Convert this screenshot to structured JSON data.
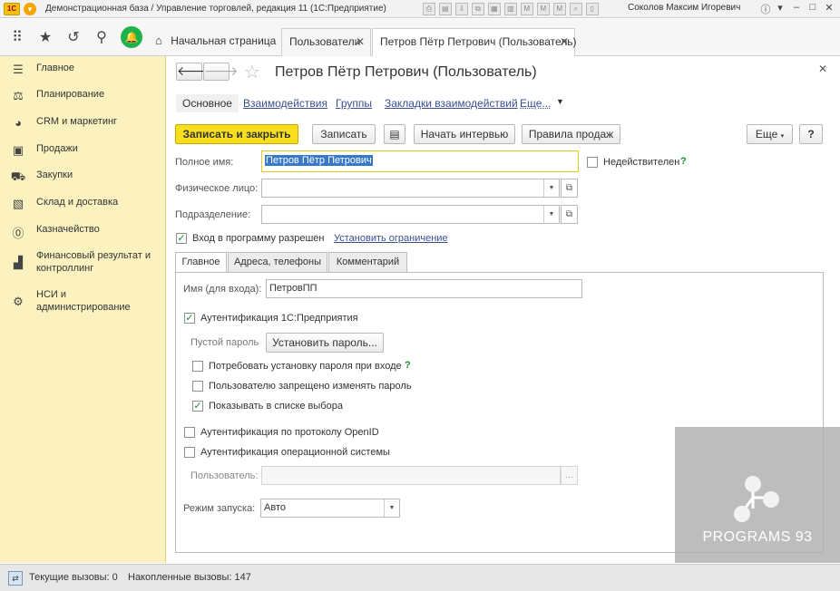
{
  "window": {
    "title": "Демонстрационная база / Управление торговлей, редакция 11  (1С:Предприятие)",
    "user": "Соколов Максим Игоревич",
    "logo_text": "1С"
  },
  "tabs": {
    "home": "Начальная страница",
    "users": "Пользователи",
    "current": "Петров Пётр Петрович (Пользователь)"
  },
  "sidebar": {
    "items": [
      {
        "label": "Главное",
        "icon": "menu-icon"
      },
      {
        "label": "Планирование",
        "icon": "planning-icon"
      },
      {
        "label": "CRM и маркетинг",
        "icon": "crm-icon"
      },
      {
        "label": "Продажи",
        "icon": "sales-icon"
      },
      {
        "label": "Закупки",
        "icon": "purchases-icon"
      },
      {
        "label": "Склад и доставка",
        "icon": "warehouse-icon"
      },
      {
        "label": "Казначейство",
        "icon": "treasury-icon"
      },
      {
        "label": "Финансовый результат и контроллинг",
        "icon": "finance-chart-icon"
      },
      {
        "label": "НСИ и администрирование",
        "icon": "gear-icon"
      }
    ]
  },
  "form": {
    "title": "Петров Пётр Петрович (Пользователь)",
    "sections": {
      "main": "Основное",
      "interactions": "Взаимодействия",
      "groups": "Группы",
      "bookmarks": "Закладки взаимодействий",
      "more": "Еще..."
    },
    "toolbar": {
      "save_close": "Записать и закрыть",
      "save": "Записать",
      "interview": "Начать интервью",
      "sales_rules": "Правила продаж",
      "more": "Еще",
      "help": "?"
    },
    "full_name_label": "Полное имя:",
    "full_name_value": "Петров Пётр Петрович",
    "invalid_label": "Недействителен",
    "person_label": "Физическое лицо:",
    "person_value": "",
    "department_label": "Подразделение:",
    "department_value": "",
    "login_allowed_label": "Вход в программу разрешен",
    "set_restriction_link": "Установить ограничение",
    "inner_tabs": {
      "main": "Главное",
      "addresses": "Адреса, телефоны",
      "comment": "Комментарий"
    },
    "login_name_label": "Имя (для входа):",
    "login_name_value": "ПетровПП",
    "auth_1c_label": "Аутентификация 1С:Предприятия",
    "empty_password_label": "Пустой пароль",
    "set_password_button": "Установить пароль...",
    "require_password_label": "Потребовать установку пароля при входе",
    "forbid_change_label": "Пользователю запрещено изменять пароль",
    "show_in_list_label": "Показывать в списке выбора",
    "openid_label": "Аутентификация по протоколу OpenID",
    "os_auth_label": "Аутентификация операционной системы",
    "os_user_label": "Пользователь:",
    "os_user_value": "",
    "launch_mode_label": "Режим запуска:",
    "launch_mode_value": "Авто",
    "states": {
      "invalid": false,
      "login_allowed": true,
      "auth_1c": true,
      "require_password": false,
      "forbid_change": false,
      "show_in_list": true,
      "openid": false,
      "os_auth": false
    }
  },
  "watermark": "PROGRAMS 93",
  "status": {
    "current_calls": "Текущие вызовы: 0",
    "accumulated_calls": "Накопленные вызовы: 147"
  },
  "colors": {
    "sidebar_bg": "#fbf2bf",
    "primary_button": "#f8de1d",
    "link": "#3a4f8f",
    "check": "#1a8f2c"
  }
}
